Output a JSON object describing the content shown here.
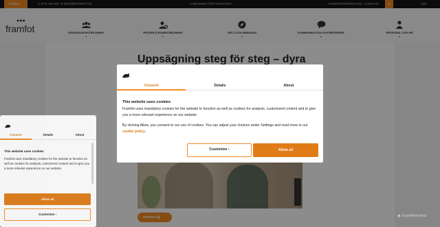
{
  "topbar": {
    "menu_label": "MENY",
    "phone": "0771-000 000",
    "email": "INFO@FRAMFOT.SE",
    "center_text": "UTBILDNING FÖR FRAMGÅNG",
    "right_text": "KOMPETENSPORTALEN · LOGGA IN",
    "lang": "SVE"
  },
  "nav": {
    "logo": "framfot",
    "items": [
      {
        "label": "LEDARSKAPSUTBILDNING",
        "icon": "people-icon"
      },
      {
        "label": "PROJEKTLEDARUTBILDNING",
        "icon": "user-gear-icon"
      },
      {
        "label": "SÄLJ OCH MARKNAD",
        "icon": "compass-icon"
      },
      {
        "label": "KOMMUNIKATION OCH BETEENDE",
        "icon": "chat-icon"
      },
      {
        "label": "PERSONAL OCH HR",
        "icon": "person-icon"
      }
    ]
  },
  "page": {
    "headline": "Uppsägning steg för steg – dyra",
    "share_label": "SKRIVUT"
  },
  "dialog": {
    "tabs": [
      "Consent",
      "Details",
      "About"
    ],
    "title": "This website uses cookies",
    "paragraph1": "Framfot uses mandatory cookies for the website to function as well as cookies for analysis, customized content and to give you a more relevant experience on our website.",
    "paragraph2": "By clicking Allow, you consent to our use of cookies. You can adjust your choices under Settings and read more in our",
    "link": "cookie policy",
    "customize_label": "Customize",
    "allow_label": "Allow all"
  },
  "mini": {
    "tabs": [
      "Consent",
      "Details",
      "About"
    ],
    "title": "This website uses cookies",
    "paragraph": "Framfot uses mandatory cookies for the website to function as well as cookies for analysis, customized content and to give you a more relevant experience on our website.",
    "allow_label": "Allow all",
    "customize_label": "Customize"
  },
  "watermark": "ScanMotovera",
  "colors": {
    "accent": "#f08a24",
    "topbar": "#141414"
  }
}
